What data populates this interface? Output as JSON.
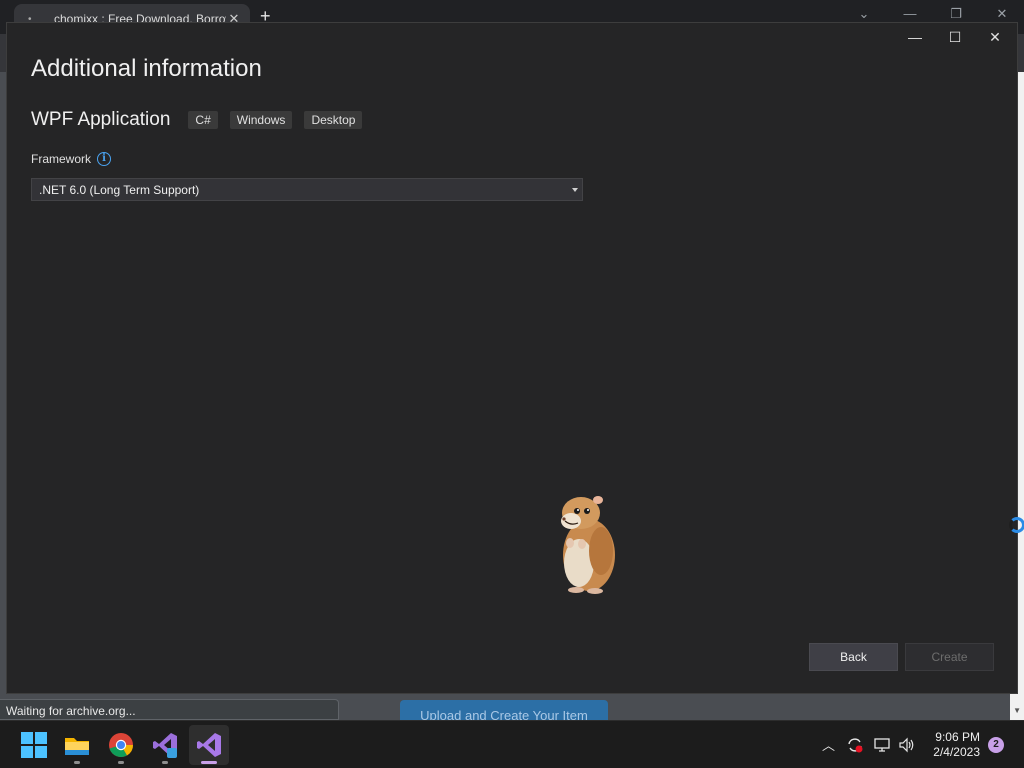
{
  "browser": {
    "tab_title": "chomixx : Free Download, Borrow",
    "tab_close": "✕",
    "new_tab": "+",
    "window_controls": [
      "⌄",
      "—",
      "❐",
      "✕"
    ],
    "status_text": "Waiting for archive.org...",
    "page_button": "Upload and Create Your Item"
  },
  "dialog": {
    "title": "Additional information",
    "project_name": "WPF Application",
    "tags": [
      "C#",
      "Windows",
      "Desktop"
    ],
    "framework_label": "Framework",
    "framework_value": ".NET 6.0 (Long Term Support)",
    "back_label": "Back",
    "create_label": "Create",
    "window_controls": [
      "—",
      "☐",
      "✕"
    ]
  },
  "taskbar": {
    "apps": [
      "start-icon",
      "file-explorer-icon",
      "chrome-icon",
      "visual-studio-preview-icon",
      "visual-studio-icon"
    ],
    "time": "9:06 PM",
    "date": "2/4/2023",
    "notification_count": "2"
  }
}
